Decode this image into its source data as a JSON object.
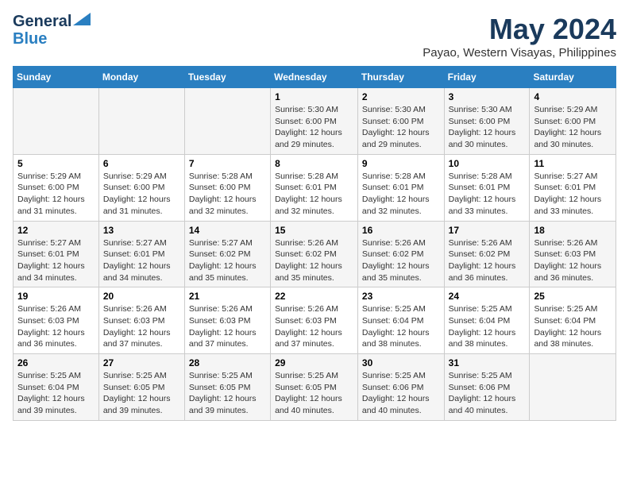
{
  "logo": {
    "line1": "General",
    "line2": "Blue"
  },
  "title": "May 2024",
  "subtitle": "Payao, Western Visayas, Philippines",
  "days_of_week": [
    "Sunday",
    "Monday",
    "Tuesday",
    "Wednesday",
    "Thursday",
    "Friday",
    "Saturday"
  ],
  "weeks": [
    [
      {
        "day": "",
        "info": ""
      },
      {
        "day": "",
        "info": ""
      },
      {
        "day": "",
        "info": ""
      },
      {
        "day": "1",
        "info": "Sunrise: 5:30 AM\nSunset: 6:00 PM\nDaylight: 12 hours\nand 29 minutes."
      },
      {
        "day": "2",
        "info": "Sunrise: 5:30 AM\nSunset: 6:00 PM\nDaylight: 12 hours\nand 29 minutes."
      },
      {
        "day": "3",
        "info": "Sunrise: 5:30 AM\nSunset: 6:00 PM\nDaylight: 12 hours\nand 30 minutes."
      },
      {
        "day": "4",
        "info": "Sunrise: 5:29 AM\nSunset: 6:00 PM\nDaylight: 12 hours\nand 30 minutes."
      }
    ],
    [
      {
        "day": "5",
        "info": "Sunrise: 5:29 AM\nSunset: 6:00 PM\nDaylight: 12 hours\nand 31 minutes."
      },
      {
        "day": "6",
        "info": "Sunrise: 5:29 AM\nSunset: 6:00 PM\nDaylight: 12 hours\nand 31 minutes."
      },
      {
        "day": "7",
        "info": "Sunrise: 5:28 AM\nSunset: 6:00 PM\nDaylight: 12 hours\nand 32 minutes."
      },
      {
        "day": "8",
        "info": "Sunrise: 5:28 AM\nSunset: 6:01 PM\nDaylight: 12 hours\nand 32 minutes."
      },
      {
        "day": "9",
        "info": "Sunrise: 5:28 AM\nSunset: 6:01 PM\nDaylight: 12 hours\nand 32 minutes."
      },
      {
        "day": "10",
        "info": "Sunrise: 5:28 AM\nSunset: 6:01 PM\nDaylight: 12 hours\nand 33 minutes."
      },
      {
        "day": "11",
        "info": "Sunrise: 5:27 AM\nSunset: 6:01 PM\nDaylight: 12 hours\nand 33 minutes."
      }
    ],
    [
      {
        "day": "12",
        "info": "Sunrise: 5:27 AM\nSunset: 6:01 PM\nDaylight: 12 hours\nand 34 minutes."
      },
      {
        "day": "13",
        "info": "Sunrise: 5:27 AM\nSunset: 6:01 PM\nDaylight: 12 hours\nand 34 minutes."
      },
      {
        "day": "14",
        "info": "Sunrise: 5:27 AM\nSunset: 6:02 PM\nDaylight: 12 hours\nand 35 minutes."
      },
      {
        "day": "15",
        "info": "Sunrise: 5:26 AM\nSunset: 6:02 PM\nDaylight: 12 hours\nand 35 minutes."
      },
      {
        "day": "16",
        "info": "Sunrise: 5:26 AM\nSunset: 6:02 PM\nDaylight: 12 hours\nand 35 minutes."
      },
      {
        "day": "17",
        "info": "Sunrise: 5:26 AM\nSunset: 6:02 PM\nDaylight: 12 hours\nand 36 minutes."
      },
      {
        "day": "18",
        "info": "Sunrise: 5:26 AM\nSunset: 6:03 PM\nDaylight: 12 hours\nand 36 minutes."
      }
    ],
    [
      {
        "day": "19",
        "info": "Sunrise: 5:26 AM\nSunset: 6:03 PM\nDaylight: 12 hours\nand 36 minutes."
      },
      {
        "day": "20",
        "info": "Sunrise: 5:26 AM\nSunset: 6:03 PM\nDaylight: 12 hours\nand 37 minutes."
      },
      {
        "day": "21",
        "info": "Sunrise: 5:26 AM\nSunset: 6:03 PM\nDaylight: 12 hours\nand 37 minutes."
      },
      {
        "day": "22",
        "info": "Sunrise: 5:26 AM\nSunset: 6:03 PM\nDaylight: 12 hours\nand 37 minutes."
      },
      {
        "day": "23",
        "info": "Sunrise: 5:25 AM\nSunset: 6:04 PM\nDaylight: 12 hours\nand 38 minutes."
      },
      {
        "day": "24",
        "info": "Sunrise: 5:25 AM\nSunset: 6:04 PM\nDaylight: 12 hours\nand 38 minutes."
      },
      {
        "day": "25",
        "info": "Sunrise: 5:25 AM\nSunset: 6:04 PM\nDaylight: 12 hours\nand 38 minutes."
      }
    ],
    [
      {
        "day": "26",
        "info": "Sunrise: 5:25 AM\nSunset: 6:04 PM\nDaylight: 12 hours\nand 39 minutes."
      },
      {
        "day": "27",
        "info": "Sunrise: 5:25 AM\nSunset: 6:05 PM\nDaylight: 12 hours\nand 39 minutes."
      },
      {
        "day": "28",
        "info": "Sunrise: 5:25 AM\nSunset: 6:05 PM\nDaylight: 12 hours\nand 39 minutes."
      },
      {
        "day": "29",
        "info": "Sunrise: 5:25 AM\nSunset: 6:05 PM\nDaylight: 12 hours\nand 40 minutes."
      },
      {
        "day": "30",
        "info": "Sunrise: 5:25 AM\nSunset: 6:06 PM\nDaylight: 12 hours\nand 40 minutes."
      },
      {
        "day": "31",
        "info": "Sunrise: 5:25 AM\nSunset: 6:06 PM\nDaylight: 12 hours\nand 40 minutes."
      },
      {
        "day": "",
        "info": ""
      }
    ]
  ]
}
